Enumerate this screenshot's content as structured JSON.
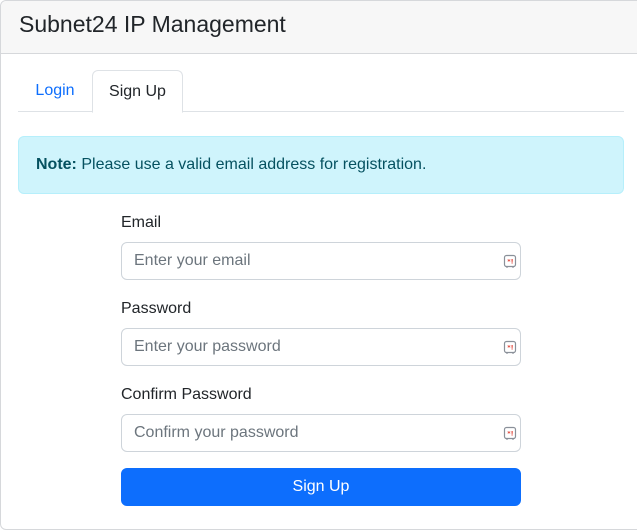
{
  "header": {
    "title": "Subnet24 IP Management"
  },
  "tabs": [
    {
      "label": "Login",
      "active": false
    },
    {
      "label": "Sign Up",
      "active": true
    }
  ],
  "alert": {
    "strong": "Note:",
    "text": " Please use a valid email address for registration."
  },
  "form": {
    "email": {
      "label": "Email",
      "placeholder": "Enter your email",
      "value": ""
    },
    "password": {
      "label": "Password",
      "placeholder": "Enter your password",
      "value": ""
    },
    "confirm": {
      "label": "Confirm Password",
      "placeholder": "Confirm your password",
      "value": ""
    },
    "submit_label": "Sign Up"
  },
  "colors": {
    "primary": "#0d6efd",
    "alert_bg": "#cff4fc",
    "alert_text": "#055160",
    "autofill_icon": "#e0453a"
  },
  "icons": {
    "field_autofill": "password-manager-key-icon"
  }
}
